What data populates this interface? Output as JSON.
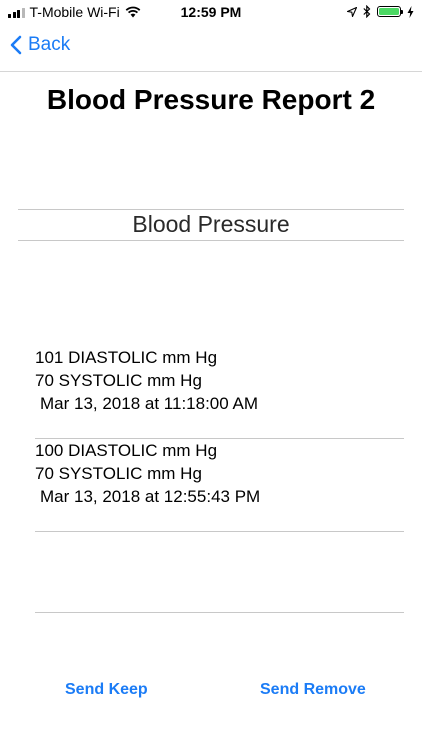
{
  "status_bar": {
    "carrier": "T-Mobile Wi-Fi",
    "time": "12:59 PM",
    "icons": [
      "signal-icon",
      "wifi-icon",
      "location-arrow-icon",
      "bluetooth-icon",
      "battery-icon",
      "charging-bolt-icon"
    ],
    "battery_color": "#4cd964"
  },
  "nav": {
    "back_label": "Back",
    "accent_color": "#1b7cf6"
  },
  "page": {
    "title": "Blood Pressure Report 2"
  },
  "section": {
    "title": "Blood Pressure"
  },
  "readings": [
    {
      "diastolic": "101 DIASTOLIC mm Hg",
      "systolic": "70 SYSTOLIC mm Hg",
      "timestamp": "Mar 13, 2018 at 11:18:00 AM"
    },
    {
      "diastolic": "100 DIASTOLIC mm Hg",
      "systolic": "70 SYSTOLIC mm Hg",
      "timestamp": "Mar 13, 2018 at 12:55:43 PM"
    }
  ],
  "actions": {
    "send_keep": "Send Keep",
    "send_remove": "Send Remove"
  }
}
